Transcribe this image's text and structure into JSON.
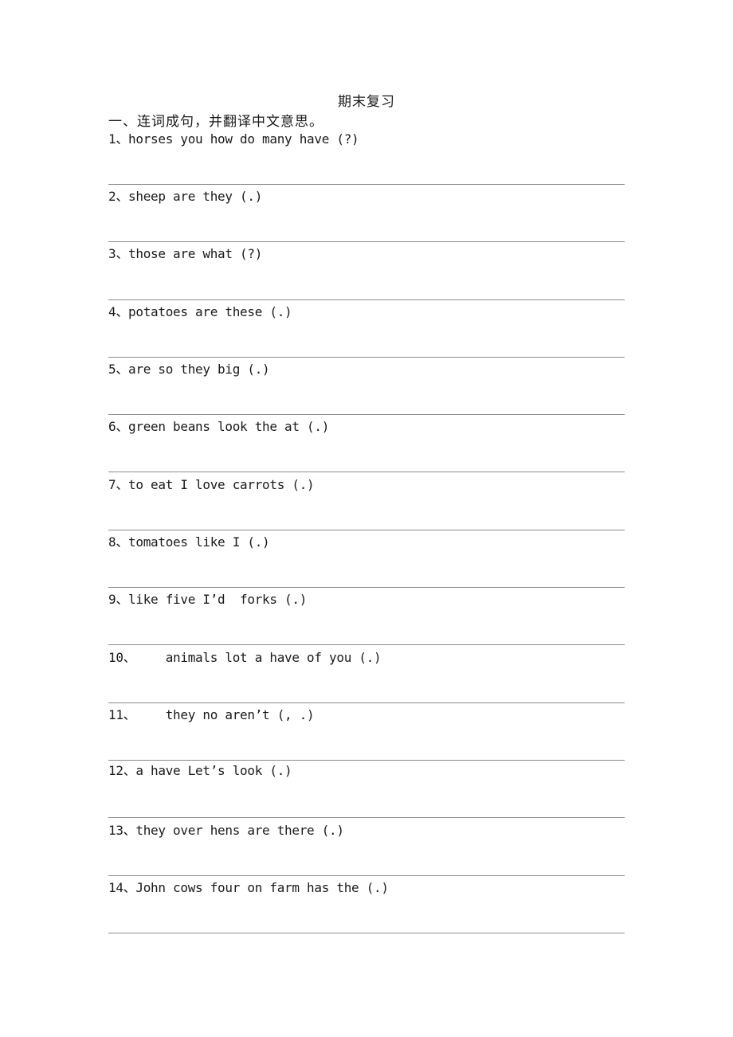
{
  "document": {
    "title": "期末复习",
    "section_heading": "一、连词成句，并翻译中文意思。",
    "questions": [
      {
        "number": "1、",
        "text": "horses you how do many have (?)"
      },
      {
        "number": "2、",
        "text": "sheep are they (.)"
      },
      {
        "number": "3、",
        "text": "those are what (?)"
      },
      {
        "number": "4、",
        "text": "potatoes are these (.)"
      },
      {
        "number": "5、",
        "text": "are so they big (.)"
      },
      {
        "number": "6、",
        "text": "green beans look the at (.)"
      },
      {
        "number": "7、",
        "text": "to eat I love carrots (.)"
      },
      {
        "number": "8、",
        "text": "tomatoes like I (.)"
      },
      {
        "number": "9、",
        "text": "like five I’d  forks (.)"
      },
      {
        "number": "10、",
        "text": "    animals lot a have of you (.)"
      },
      {
        "number": "11、",
        "text": "    they no aren’t (, .)"
      },
      {
        "number": "12、",
        "text": "a have Let’s look (.)"
      },
      {
        "number": "13、",
        "text": "they over hens are there (.)"
      },
      {
        "number": "14、",
        "text": "John cows four on farm has the (.)"
      }
    ]
  }
}
